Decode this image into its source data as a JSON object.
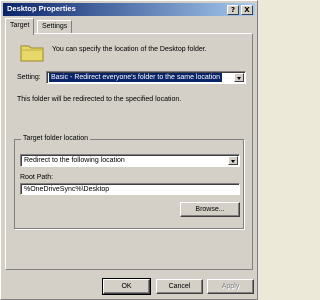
{
  "window": {
    "title": "Desktop Properties",
    "help_label": "?",
    "close_label": "X"
  },
  "tabs": [
    {
      "label": "Target"
    },
    {
      "label": "Settings"
    }
  ],
  "target": {
    "intro_text": "You can specify the location of the Desktop folder.",
    "setting_label": "Setting:",
    "setting_value": "Basic - Redirect everyone's folder to the same location",
    "redirect_text": "This folder will be redirected to the specified location.",
    "group": {
      "title": "Target folder location",
      "location_value": "Redirect to the following location",
      "root_path_label": "Root Path:",
      "root_path_value": "%OneDriveSync%\\Desktop",
      "browse_label": "Browse..."
    }
  },
  "footer": {
    "ok_label": "OK",
    "cancel_label": "Cancel",
    "apply_label": "Apply"
  }
}
